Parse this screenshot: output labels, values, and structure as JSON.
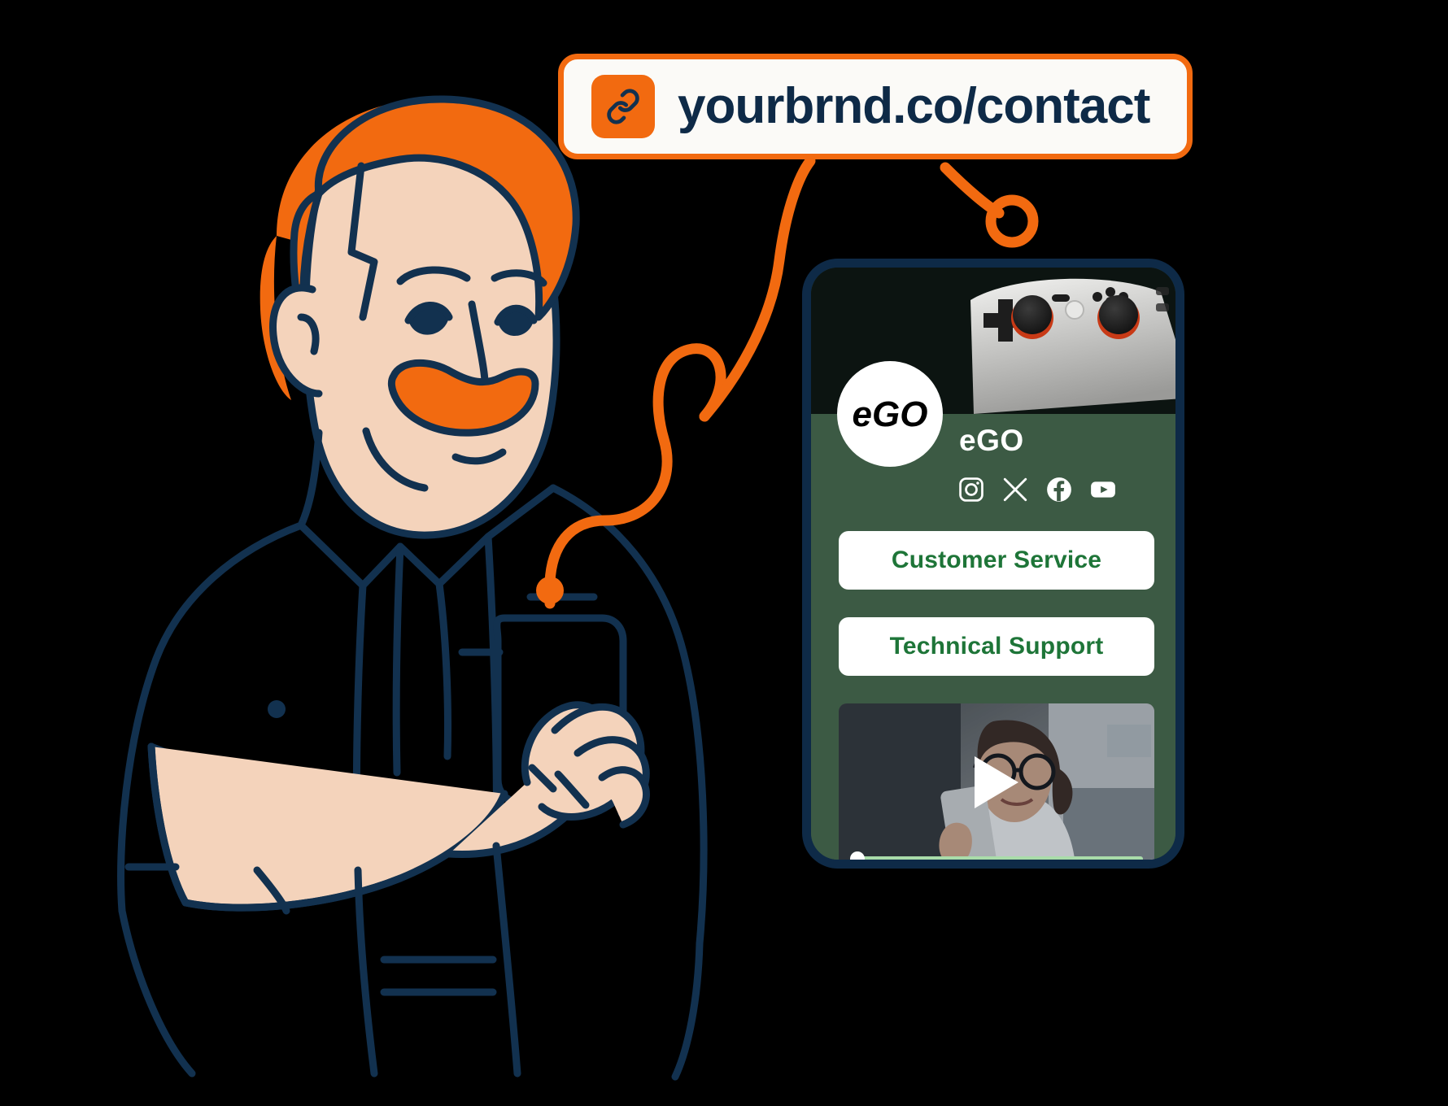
{
  "url_pill": {
    "icon": "link-icon",
    "url": "yourbrnd.co/contact",
    "border_color": "#F26A10",
    "text_color": "#0E2A47",
    "badge_color": "#F26A10"
  },
  "illustration": {
    "name": "man-holding-phone-illustration",
    "hair_color": "#F26A10",
    "skin_color": "#F4D3BB",
    "line_color": "#12314F"
  },
  "connectors": {
    "color": "#F26A10",
    "endpoint_ring": "open-circle",
    "endpoint_dot": "filled-dot"
  },
  "phone": {
    "frame_color": "#0E2A47",
    "background_color": "#3C5A44",
    "cover_image": "game-controller-photo",
    "profile": {
      "avatar_logo": "eGO",
      "display_name": "eGO",
      "socials": [
        {
          "name": "instagram-icon",
          "label": "Instagram"
        },
        {
          "name": "x-icon",
          "label": "X"
        },
        {
          "name": "facebook-icon",
          "label": "Facebook"
        },
        {
          "name": "youtube-icon",
          "label": "YouTube"
        }
      ]
    },
    "links": [
      {
        "label": "Customer Service",
        "name": "link-button-customer-service"
      },
      {
        "label": "Technical Support",
        "name": "link-button-technical-support"
      }
    ],
    "video": {
      "thumbnail": "woman-with-glasses-holding-phone",
      "play_icon": "play-triangle-icon",
      "progress_percent": 2,
      "track_color": "#A9DCA9",
      "knob_color": "#FFFFFF"
    },
    "link_text_color": "#1E7538",
    "link_bg_color": "#FFFFFF"
  }
}
